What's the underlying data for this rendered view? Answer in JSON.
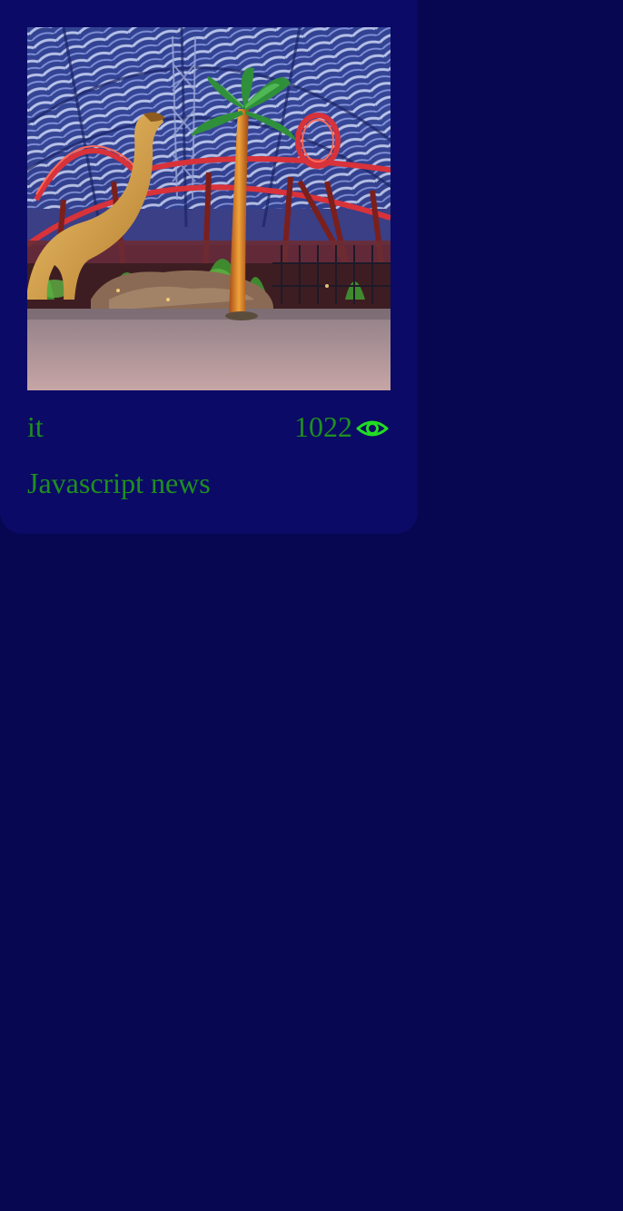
{
  "card": {
    "category": "it",
    "views": "1022",
    "title": "Javascript news",
    "image_alt": "Indoor theme park with roller coaster, palm tree and dinosaur"
  },
  "icons": {
    "views": "eye-icon"
  },
  "colors": {
    "background": "#070751",
    "card": "#0b0a66",
    "text": "#1f8f1f",
    "icon": "#22dd22"
  }
}
